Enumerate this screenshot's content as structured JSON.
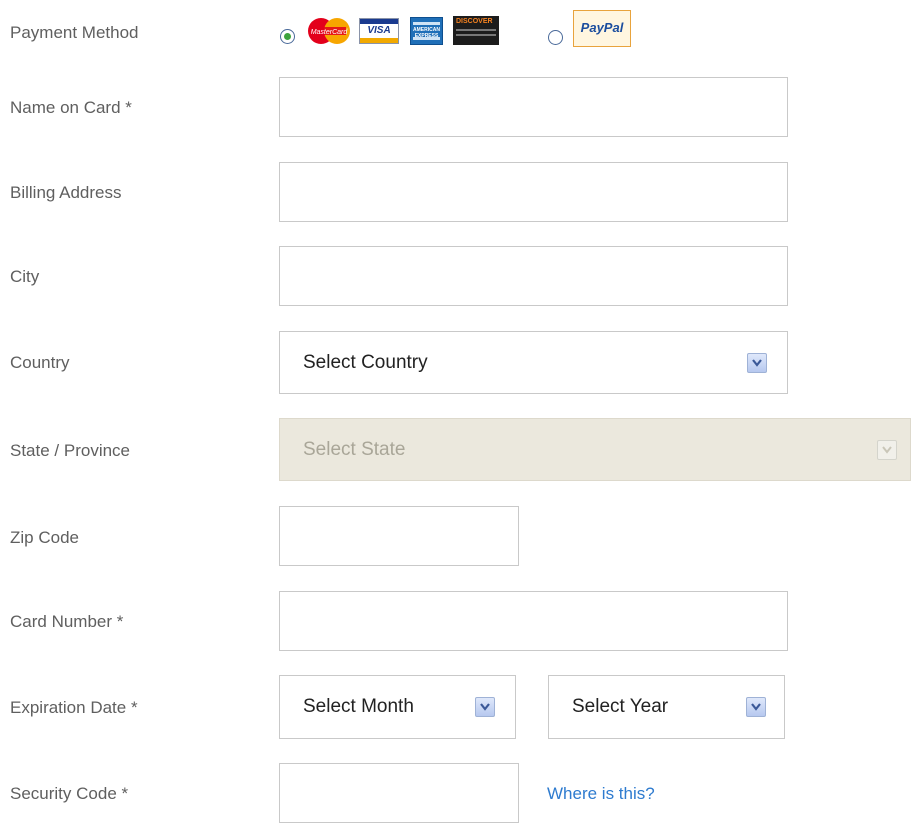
{
  "payment_method": {
    "label": "Payment Method",
    "card_logos": [
      "MasterCard",
      "VISA",
      "AMERICAN EXPRESS",
      "DISCOVER"
    ],
    "paypal_logo": "PayPal",
    "selected": "card"
  },
  "name_on_card": {
    "label": "Name on Card *",
    "value": ""
  },
  "billing_address": {
    "label": "Billing Address",
    "value": ""
  },
  "city": {
    "label": "City",
    "value": ""
  },
  "country": {
    "label": "Country",
    "selected": "Select Country"
  },
  "state": {
    "label": "State / Province",
    "selected": "Select State",
    "disabled": true
  },
  "zip": {
    "label": "Zip Code",
    "value": ""
  },
  "card_number": {
    "label": "Card Number *",
    "value": ""
  },
  "expiration": {
    "label": "Expiration Date *",
    "month": "Select Month",
    "year": "Select Year"
  },
  "security_code": {
    "label": "Security Code *",
    "value": "",
    "help_link": "Where is this?"
  },
  "colors": {
    "link": "#2e7bcf",
    "disabled_bg": "#ebe8dd",
    "radio_selected": "#3da33d"
  }
}
